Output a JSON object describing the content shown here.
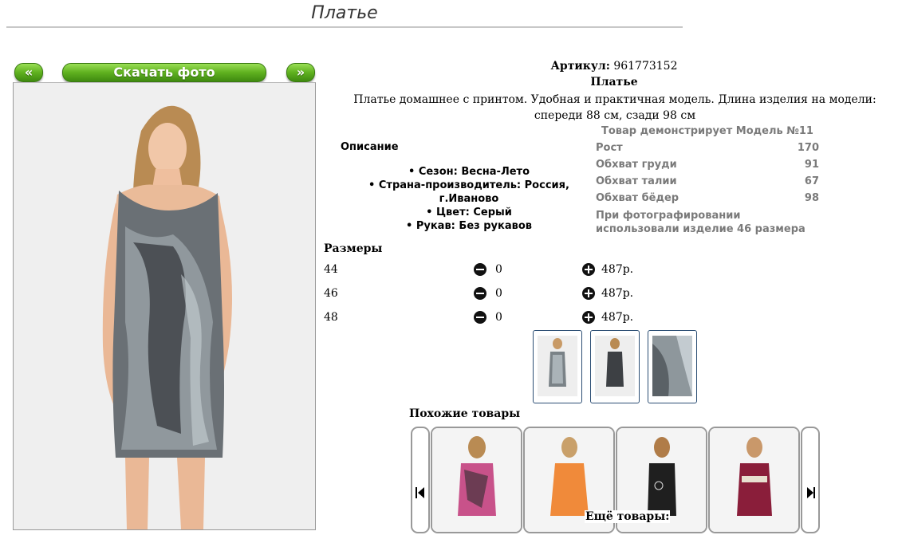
{
  "page": {
    "title": "Платье"
  },
  "photo_controls": {
    "prev": "«",
    "download": "Скачать фото",
    "next": "»"
  },
  "product": {
    "article_label": "Артикул:",
    "article_value": "961773152",
    "name": "Платье",
    "description": "Платье домашнее с принтом. Удобная и практичная модель. Длина изделия на модели: спереди 88 см, сзади 98 см"
  },
  "description_section": {
    "heading": "Описание",
    "items": [
      "Сезон: Весна-Лето",
      "Страна-производитель: Россия, г.Иваново",
      "Цвет: Серый",
      "Рукав: Без рукавов"
    ]
  },
  "model": {
    "heading": "Товар демонстрирует Модель №11",
    "rows": [
      {
        "label": "Рост",
        "value": "170"
      },
      {
        "label": "Обхват груди",
        "value": "91"
      },
      {
        "label": "Обхват талии",
        "value": "67"
      },
      {
        "label": "Обхват бёдер",
        "value": "98"
      }
    ],
    "note": "При фотографировании использовали изделие 46 размера"
  },
  "sizes": {
    "heading": "Размеры",
    "rows": [
      {
        "size": "44",
        "qty": "0",
        "price": "487р."
      },
      {
        "size": "46",
        "qty": "0",
        "price": "487р."
      },
      {
        "size": "48",
        "qty": "0",
        "price": "487р."
      }
    ]
  },
  "similar": {
    "heading": "Похожие товары"
  },
  "more": {
    "heading": "Ещё товары:"
  },
  "colors": {
    "button_green": "#5fb11f",
    "thumb_border": "#2c4e74",
    "model_text": "#7a7a7a"
  }
}
